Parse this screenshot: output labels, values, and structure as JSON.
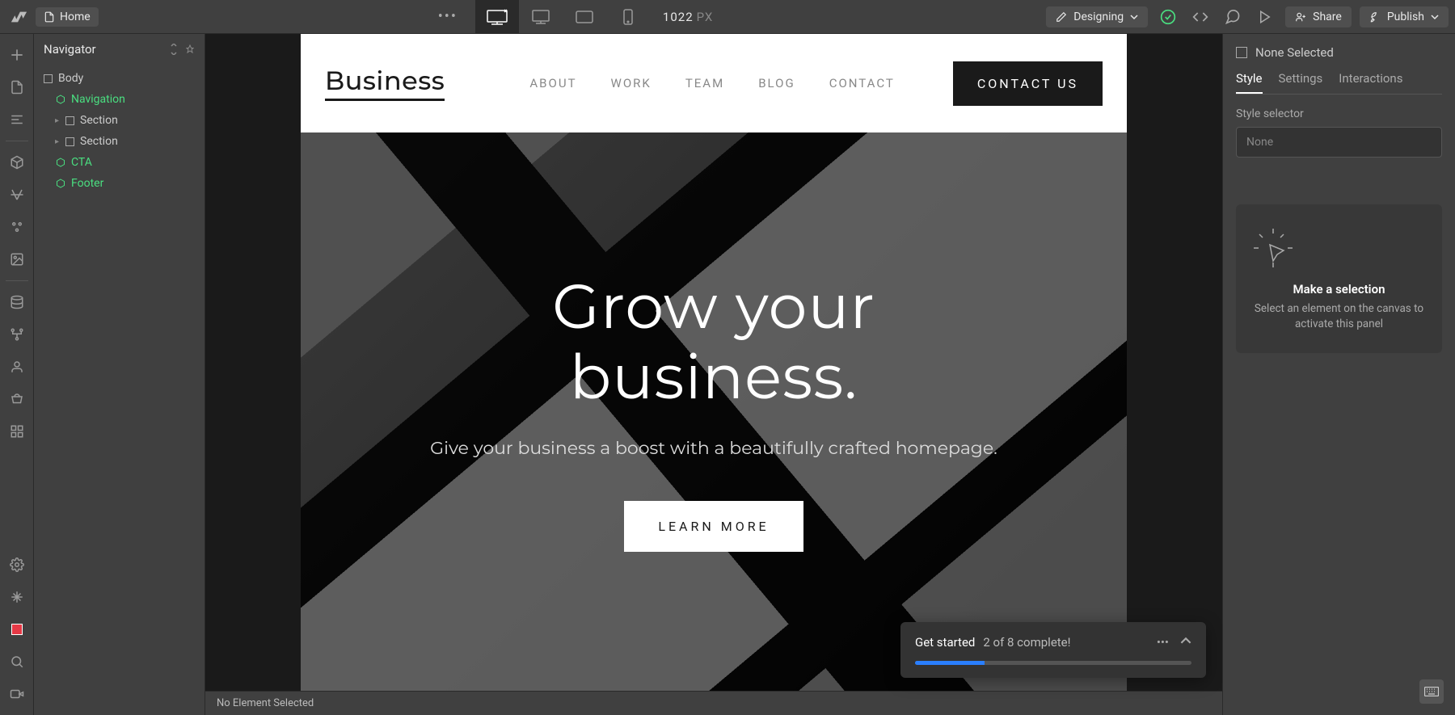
{
  "topbar": {
    "home": "Home",
    "viewport_value": "1022",
    "viewport_unit": "PX",
    "mode": "Designing",
    "share": "Share",
    "publish": "Publish"
  },
  "navigator": {
    "title": "Navigator",
    "items": [
      {
        "label": "Body",
        "type": "body",
        "indent": 0
      },
      {
        "label": "Navigation",
        "type": "component",
        "indent": 1,
        "green": true
      },
      {
        "label": "Section",
        "type": "box",
        "indent": 1,
        "caret": true
      },
      {
        "label": "Section",
        "type": "box",
        "indent": 1,
        "caret": true
      },
      {
        "label": "CTA",
        "type": "component",
        "indent": 1,
        "green": true
      },
      {
        "label": "Footer",
        "type": "component",
        "indent": 1,
        "green": true
      }
    ]
  },
  "canvas": {
    "site_logo": "Business",
    "menu": [
      "ABOUT",
      "WORK",
      "TEAM",
      "BLOG",
      "CONTACT"
    ],
    "cta": "CONTACT US",
    "hero_title_l1": "Grow your",
    "hero_title_l2": "business.",
    "hero_sub": "Give your business a boost with a beautifully crafted homepage.",
    "hero_btn": "LEARN MORE"
  },
  "status_bar": "No Element Selected",
  "onboard": {
    "title": "Get started",
    "progress": "2 of 8 complete!",
    "percent": 25
  },
  "right": {
    "selection": "None Selected",
    "tabs": [
      "Style",
      "Settings",
      "Interactions"
    ],
    "selector_label": "Style selector",
    "selector_value": "None",
    "empty_title": "Make a selection",
    "empty_sub": "Select an element on the canvas to activate this panel"
  }
}
